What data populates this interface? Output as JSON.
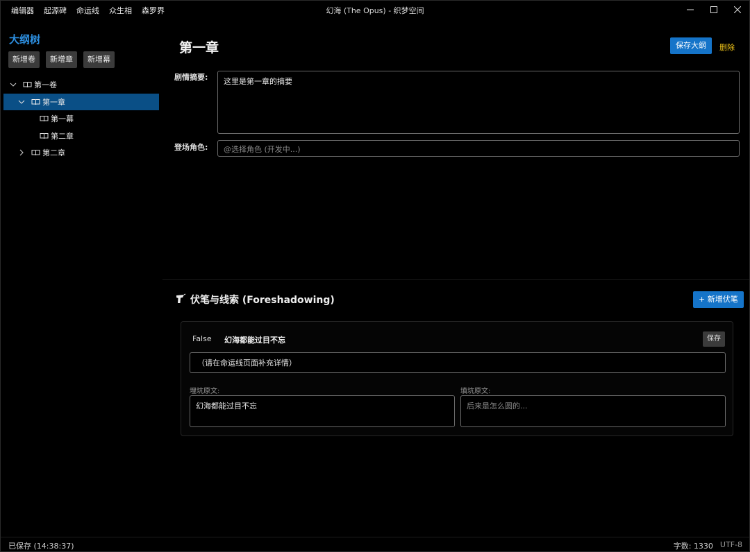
{
  "titlebar": {
    "menu": [
      "编辑器",
      "起源碑",
      "命运线",
      "众生相",
      "森罗界"
    ],
    "title": "幻海 (The Opus) - 织梦空间"
  },
  "sidebar": {
    "title": "大纲树",
    "buttons": [
      "新增卷",
      "新增章",
      "新增幕"
    ],
    "tree": [
      {
        "label": "第一卷",
        "level": 0,
        "expanded": true,
        "selected": false
      },
      {
        "label": "第一章",
        "level": 1,
        "expanded": true,
        "selected": true
      },
      {
        "label": "第一幕",
        "level": 2,
        "expanded": null,
        "selected": false
      },
      {
        "label": "第二章",
        "level": 2,
        "expanded": null,
        "selected": false
      },
      {
        "label": "第二章",
        "level": 1,
        "expanded": false,
        "selected": false
      }
    ]
  },
  "editor": {
    "title": "第一章",
    "save_label": "保存大纲",
    "delete_label": "删除",
    "summary_label": "剧情摘要:",
    "summary_value": "这里是第一章的摘要",
    "characters_label": "登场角色:",
    "characters_placeholder": "@选择角色 (开发中...)"
  },
  "foreshadowing": {
    "icon": "quill-icon",
    "title": "伏笔与线索 (Foreshadowing)",
    "add_label": "+ 新增伏笔",
    "items": [
      {
        "status": "False",
        "name": "幻海都能过目不忘",
        "save_label": "保存",
        "detail": "（请在命运线页面补充详情）",
        "bury_label": "埋坑原文:",
        "bury_text": "幻海都能过目不忘",
        "fill_label": "填坑原文:",
        "fill_placeholder": "后来是怎么圆的..."
      }
    ]
  },
  "statusbar": {
    "saved": "已保存 (14:38:37)",
    "word_count": "字数: 1330",
    "encoding": "UTF-8"
  },
  "colors": {
    "accent": "#1574c9",
    "sidebar_title": "#2d8fe0",
    "delete": "#f0c419",
    "selected_row": "#0a4f86"
  }
}
